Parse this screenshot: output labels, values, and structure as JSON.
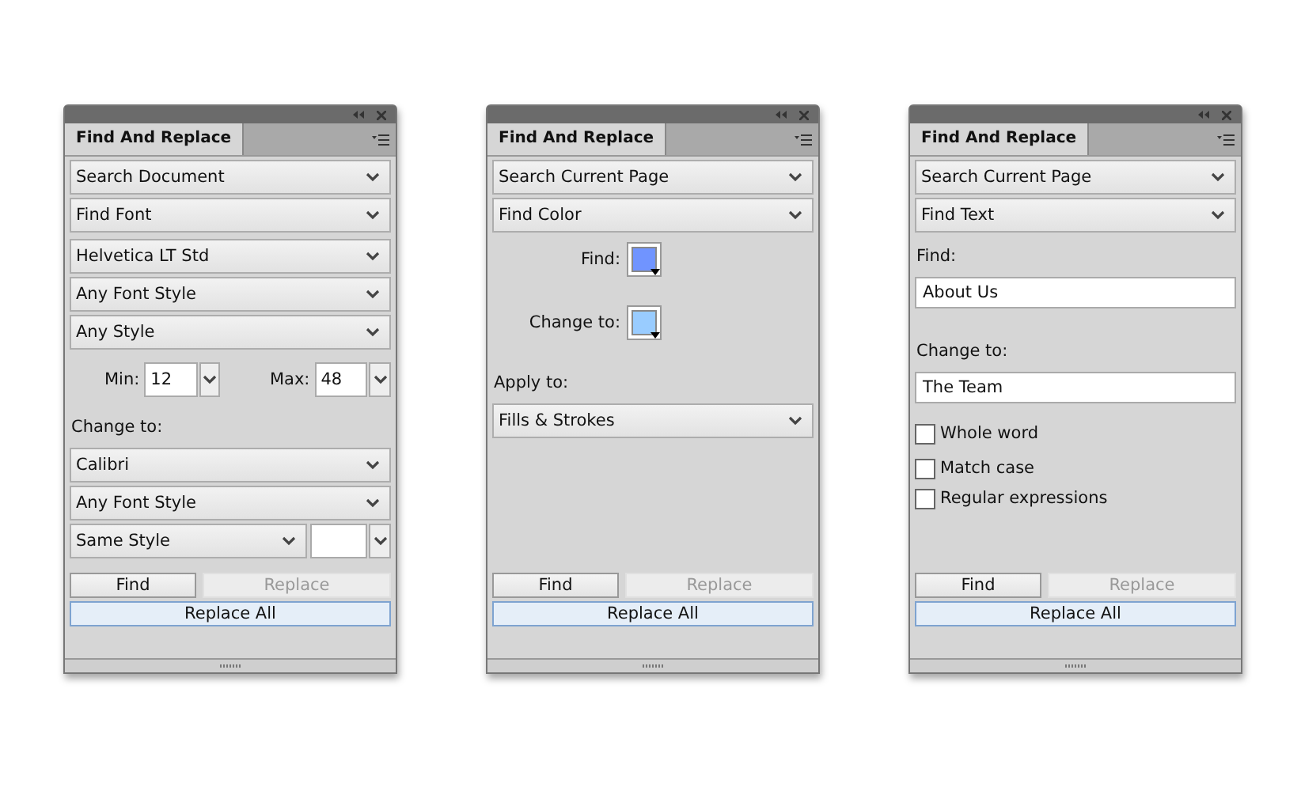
{
  "panels": [
    {
      "title": "Find And Replace",
      "rows": [
        {
          "kind": "dropdown",
          "value": "Search Document"
        },
        {
          "kind": "dropdown",
          "value": "Find Font"
        },
        {
          "kind": "dropdown",
          "value": "Helvetica LT Std"
        },
        {
          "kind": "dropdown",
          "value": "Any Font Style"
        },
        {
          "kind": "dropdown",
          "value": "Any Style"
        },
        {
          "kind": "range",
          "min_label": "Min:",
          "min_value": "12",
          "max_label": "Max:",
          "max_value": "48"
        },
        {
          "kind": "label",
          "text": "Change to:"
        },
        {
          "kind": "dropdown",
          "value": "Calibri"
        },
        {
          "kind": "dropdown",
          "value": "Any Font Style"
        },
        {
          "kind": "dropdown_field",
          "value": "Same Style"
        }
      ],
      "buttons": [
        {
          "label": "Find",
          "disabled": false
        },
        {
          "label": "Replace",
          "disabled": true
        }
      ],
      "replace_all": "Replace All"
    },
    {
      "title": "Find And Replace",
      "rows": [
        {
          "kind": "dropdown",
          "value": "Search Current Page"
        },
        {
          "kind": "dropdown",
          "value": "Find Color"
        },
        {
          "kind": "swatch",
          "label": "Find:",
          "color": "#7094ff"
        },
        {
          "kind": "swatch",
          "label": "Change to:",
          "color": "#99ccff"
        },
        {
          "kind": "label",
          "text": "Apply to:"
        },
        {
          "kind": "dropdown",
          "value": "Fills & Strokes"
        }
      ],
      "buttons": [
        {
          "label": "Find",
          "disabled": false
        },
        {
          "label": "Replace",
          "disabled": true
        }
      ],
      "replace_all": "Replace All"
    },
    {
      "title": "Find And Replace",
      "rows": [
        {
          "kind": "dropdown",
          "value": "Search Current Page"
        },
        {
          "kind": "dropdown",
          "value": "Find Text"
        },
        {
          "kind": "label",
          "text": "Find:"
        },
        {
          "kind": "text_field",
          "value": "About Us"
        },
        {
          "kind": "label",
          "text": "Change to:"
        },
        {
          "kind": "text_field",
          "value": "The Team"
        },
        {
          "kind": "checkbox",
          "label": "Whole word",
          "checked": false
        },
        {
          "kind": "checkbox",
          "label": "Match case",
          "checked": false
        },
        {
          "kind": "checkbox",
          "label": "Regular expressions",
          "checked": false
        }
      ],
      "buttons": [
        {
          "label": "Find",
          "disabled": false
        },
        {
          "label": "Replace",
          "disabled": true
        }
      ],
      "replace_all": "Replace All"
    }
  ]
}
